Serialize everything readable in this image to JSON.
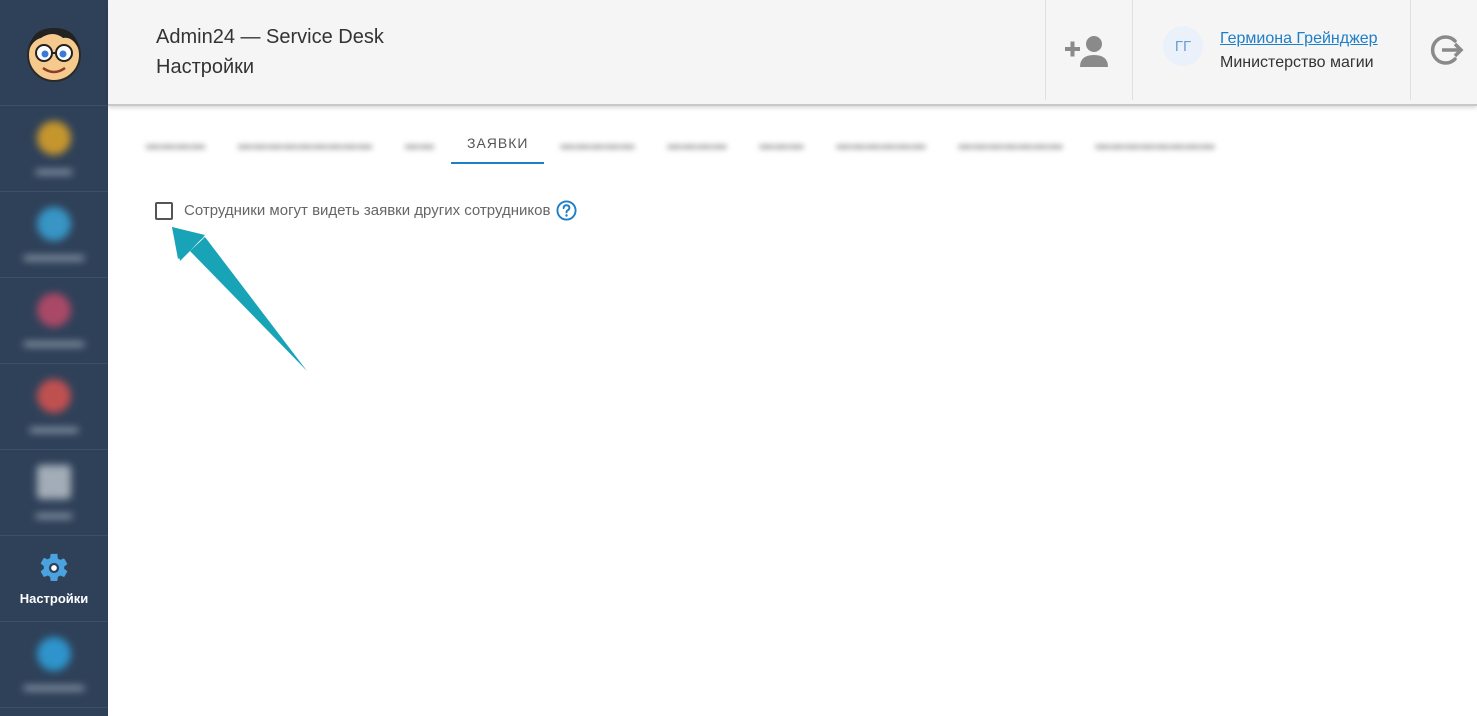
{
  "header": {
    "app_title": "Admin24 — Service Desk",
    "page_title": "Настройки"
  },
  "user": {
    "initials": "ГГ",
    "name": "Гермиона Грейнджер",
    "organization": "Министерство магии"
  },
  "sidebar": {
    "items": [
      {
        "icon": "blurred-icon",
        "color": "#e0a526"
      },
      {
        "icon": "blurred-icon",
        "color": "#3aa4d8"
      },
      {
        "icon": "blurred-icon",
        "color": "#c04a6a"
      },
      {
        "icon": "blurred-icon",
        "color": "#d9534f"
      },
      {
        "icon": "blurred-icon",
        "color": "#b8c0c8"
      },
      {
        "icon": "gear-icon",
        "label": "Настройки",
        "active": true
      },
      {
        "icon": "blurred-icon",
        "color": "#2ea3e0"
      }
    ]
  },
  "tabs": [
    {
      "blurred": true
    },
    {
      "blurred": true
    },
    {
      "blurred": true
    },
    {
      "label": "ЗАЯВКИ",
      "active": true
    },
    {
      "blurred": true
    },
    {
      "blurred": true
    },
    {
      "blurred": true
    },
    {
      "blurred": true
    },
    {
      "blurred": true
    },
    {
      "blurred": true
    }
  ],
  "settings": {
    "employees_see_others": {
      "label": "Сотрудники могут видеть заявки других сотрудников",
      "checked": false
    }
  },
  "colors": {
    "sidebar_bg": "#2f4159",
    "accent": "#1e7ec8",
    "arrow": "#18a3b7"
  }
}
